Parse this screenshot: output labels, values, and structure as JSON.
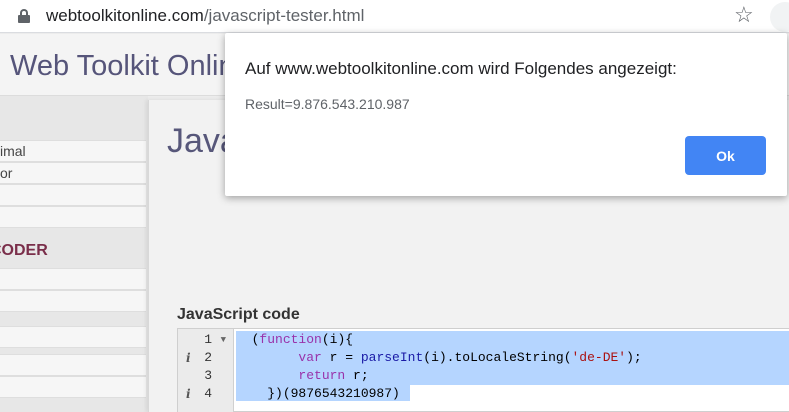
{
  "browser": {
    "url_domain": "webtoolkitonline.com",
    "url_path": "/javascript-tester.html",
    "lock_icon": "lock-icon",
    "star_icon": "star-icon"
  },
  "site": {
    "title": "Web Toolkit Onlin"
  },
  "sidebar": {
    "items": [
      "imal",
      "or",
      "",
      ""
    ],
    "heading": "CODER",
    "lower_items": [
      "",
      "",
      "",
      "",
      ""
    ]
  },
  "content": {
    "title": "Java",
    "code_label": "JavaScript code"
  },
  "editor": {
    "line_numbers": [
      "1",
      "2",
      "3",
      "4"
    ],
    "lines": [
      {
        "indent": "  ",
        "parts": [
          [
            "(",
            "fn"
          ],
          [
            "function",
            "kw"
          ],
          [
            "(i){",
            "fn"
          ]
        ]
      },
      {
        "indent": "        ",
        "parts": [
          [
            "var",
            "kw"
          ],
          [
            " r = ",
            "fn"
          ],
          [
            "parseInt",
            "kw-blue"
          ],
          [
            "(i).toLocaleString(",
            "fn"
          ],
          [
            "'de-DE'",
            "str"
          ],
          [
            ");",
            "fn"
          ]
        ]
      },
      {
        "indent": "        ",
        "parts": [
          [
            "return",
            "kw"
          ],
          [
            " r;",
            "fn"
          ]
        ]
      },
      {
        "indent": "    ",
        "parts": [
          [
            "})(9876543210987)",
            "fn"
          ]
        ]
      }
    ]
  },
  "dialog": {
    "title": "Auf www.webtoolkitonline.com wird Folgendes angezeigt:",
    "message": "Result=9.876.543.210.987",
    "ok_label": "Ok",
    "button_color": "#4285f4"
  }
}
